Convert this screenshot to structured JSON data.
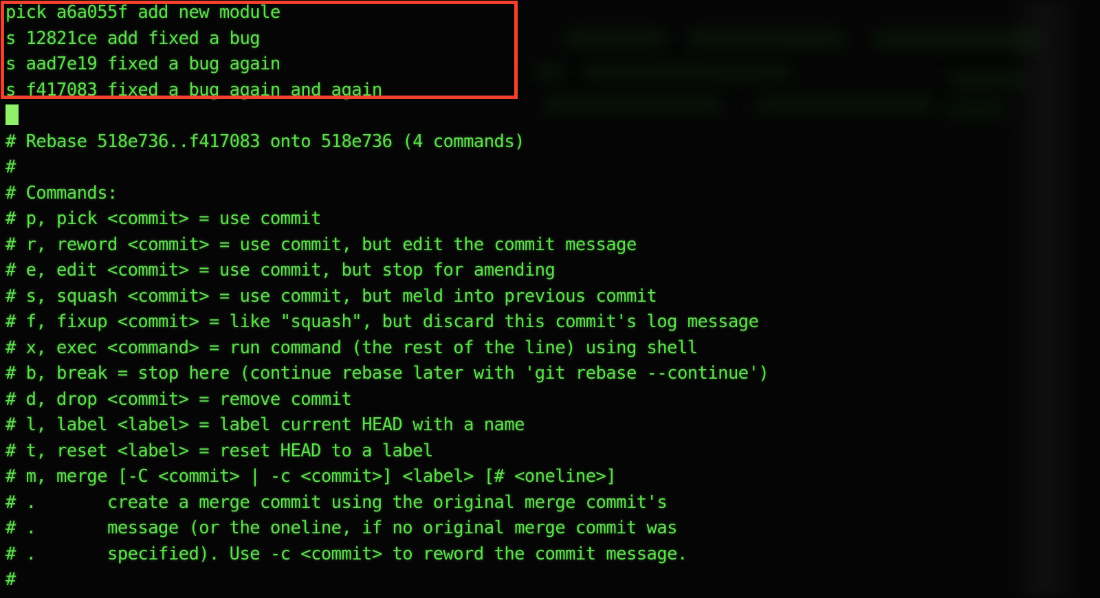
{
  "terminal": {
    "kind": "git-interactive-rebase-todo-editor",
    "colors": {
      "background": "#050505",
      "foreground": "#5fdf4f",
      "cursor": "#8ff06a",
      "annotation": "#f4402c"
    },
    "cursor": {
      "row": 5,
      "column": 1,
      "shape": "block"
    }
  },
  "annotation": {
    "label": "rebase-todo-highlight",
    "color": "#f4402c",
    "covers_rows": [
      1,
      2,
      3,
      4
    ]
  },
  "todo": {
    "entries": [
      {
        "command": "pick",
        "hash": "a6a055f",
        "subject": "add new module",
        "text": "pick a6a055f add new module"
      },
      {
        "command": "s",
        "hash": "12821ce",
        "subject": "add fixed a bug",
        "text": "s 12821ce add fixed a bug"
      },
      {
        "command": "s",
        "hash": "aad7e19",
        "subject": "fixed a bug again",
        "text": "s aad7e19 fixed a bug again"
      },
      {
        "command": "s",
        "hash": "f417083",
        "subject": "fixed a bug again and again",
        "text": "s f417083 fixed a bug again and again"
      }
    ]
  },
  "rebase_header": {
    "upstream": "518e736",
    "head": "f417083",
    "onto": "518e736",
    "command_count": "4",
    "text": "# Rebase 518e736..f417083 onto 518e736 (4 commands)"
  },
  "help": {
    "blank_comment": "#",
    "heading": "# Commands:",
    "lines": [
      "# p, pick <commit> = use commit",
      "# r, reword <commit> = use commit, but edit the commit message",
      "# e, edit <commit> = use commit, but stop for amending",
      "# s, squash <commit> = use commit, but meld into previous commit",
      "# f, fixup <commit> = like \"squash\", but discard this commit's log message",
      "# x, exec <command> = run command (the rest of the line) using shell",
      "# b, break = stop here (continue rebase later with 'git rebase --continue')",
      "# d, drop <commit> = remove commit",
      "# l, label <label> = label current HEAD with a name",
      "# t, reset <label> = reset HEAD to a label",
      "# m, merge [-C <commit> | -c <commit>] <label> [# <oneline>]",
      "# .       create a merge commit using the original merge commit's",
      "# .       message (or the oneline, if no original merge commit was",
      "# .       specified). Use -c <commit> to reword the commit message."
    ]
  },
  "screen_lines": [
    "pick a6a055f add new module",
    "s 12821ce add fixed a bug",
    "s aad7e19 fixed a bug again",
    "s f417083 fixed a bug again and again",
    "",
    "# Rebase 518e736..f417083 onto 518e736 (4 commands)",
    "#",
    "# Commands:",
    "# p, pick <commit> = use commit",
    "# r, reword <commit> = use commit, but edit the commit message",
    "# e, edit <commit> = use commit, but stop for amending",
    "# s, squash <commit> = use commit, but meld into previous commit",
    "# f, fixup <commit> = like \"squash\", but discard this commit's log message",
    "# x, exec <command> = run command (the rest of the line) using shell",
    "# b, break = stop here (continue rebase later with 'git rebase --continue')",
    "# d, drop <commit> = remove commit",
    "# l, label <label> = label current HEAD with a name",
    "# t, reset <label> = reset HEAD to a label",
    "# m, merge [-C <commit> | -c <commit>] <label> [# <oneline>]",
    "# .       create a merge commit using the original merge commit's",
    "# .       message (or the oneline, if no original merge commit was",
    "# .       specified). Use -c <commit> to reword the commit message.",
    "#"
  ]
}
